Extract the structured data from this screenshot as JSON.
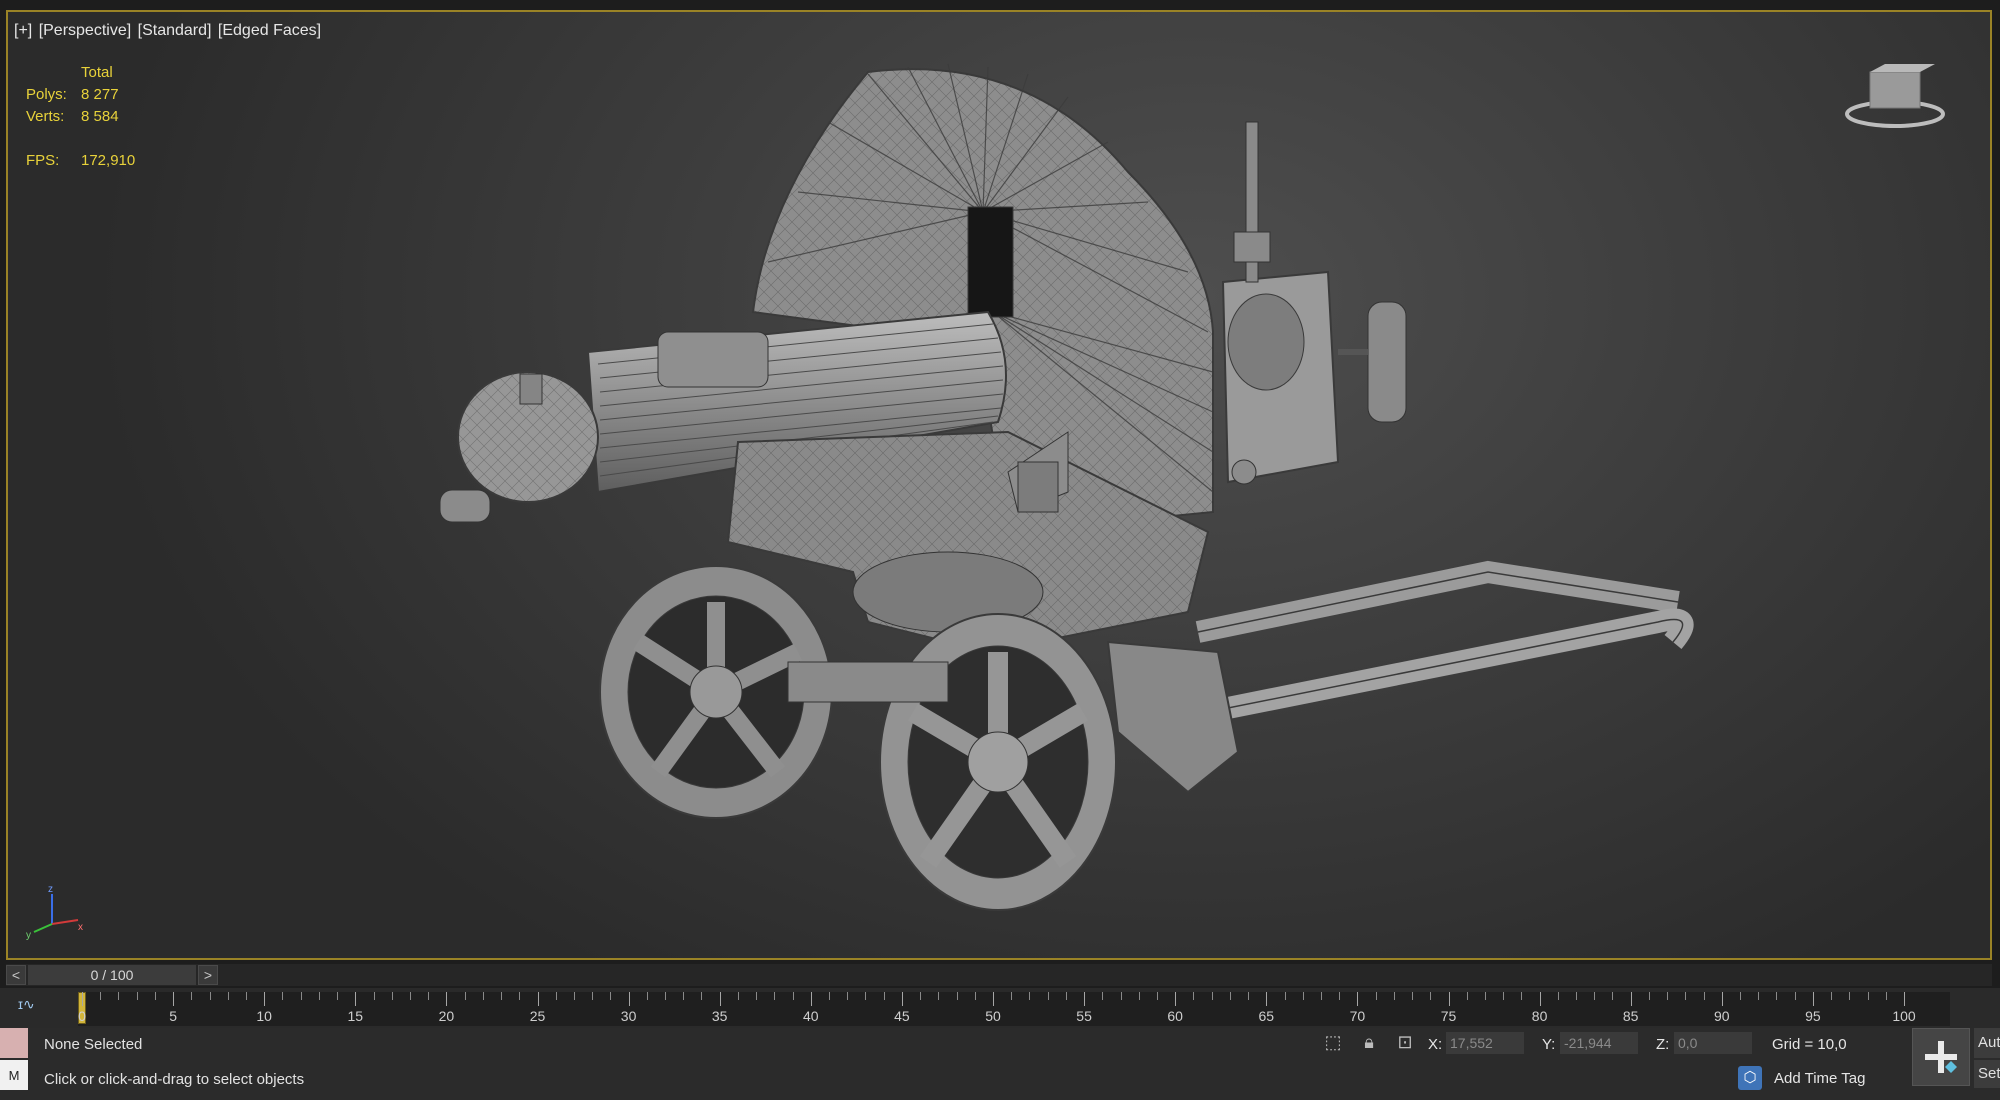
{
  "viewport": {
    "labels": [
      "[+]",
      "[Perspective]",
      "[Standard]",
      "[Edged Faces]"
    ],
    "stats": {
      "header": "Total",
      "polys_label": "Polys:",
      "polys_value": "8 277",
      "verts_label": "Verts:",
      "verts_value": "8 584",
      "fps_label": "FPS:",
      "fps_value": "172,910"
    },
    "border_color": "#9a8326",
    "stats_color": "#e8d23a",
    "viewcube_icon": "viewcube-icon",
    "axis_icon": "axis-tripod-icon",
    "axis_labels": [
      "z",
      "y",
      "x"
    ]
  },
  "time_slider": {
    "prev_label": "<",
    "next_label": ">",
    "frame_text": "0 / 100"
  },
  "track_bar": {
    "curve_icon": "mini-curve-editor-icon",
    "tick_labels": [
      "0",
      "5",
      "10",
      "15",
      "20",
      "25",
      "30",
      "35",
      "40",
      "45",
      "50",
      "55",
      "60",
      "65",
      "70",
      "75",
      "80",
      "85",
      "90",
      "95",
      "100"
    ],
    "current_frame": 0
  },
  "status_bar": {
    "selection": "None Selected",
    "prompt": "Click or click-and-drag to select objects",
    "maxscript_label": "M",
    "x_label": "X:",
    "x_value": "17,552",
    "y_label": "Y:",
    "y_value": "-21,944",
    "z_label": "Z:",
    "z_value": "0,0",
    "grid": "Grid = 10,0",
    "add_time_tag": "Add Time Tag",
    "auto_key": "Auto",
    "set_key": "Set",
    "swatch_color": "#d7b0b0",
    "icons": [
      "isolate-selection-icon",
      "lock-selection-icon",
      "absolute-mode-icon",
      "time-tag-icon",
      "set-key-icon"
    ]
  }
}
